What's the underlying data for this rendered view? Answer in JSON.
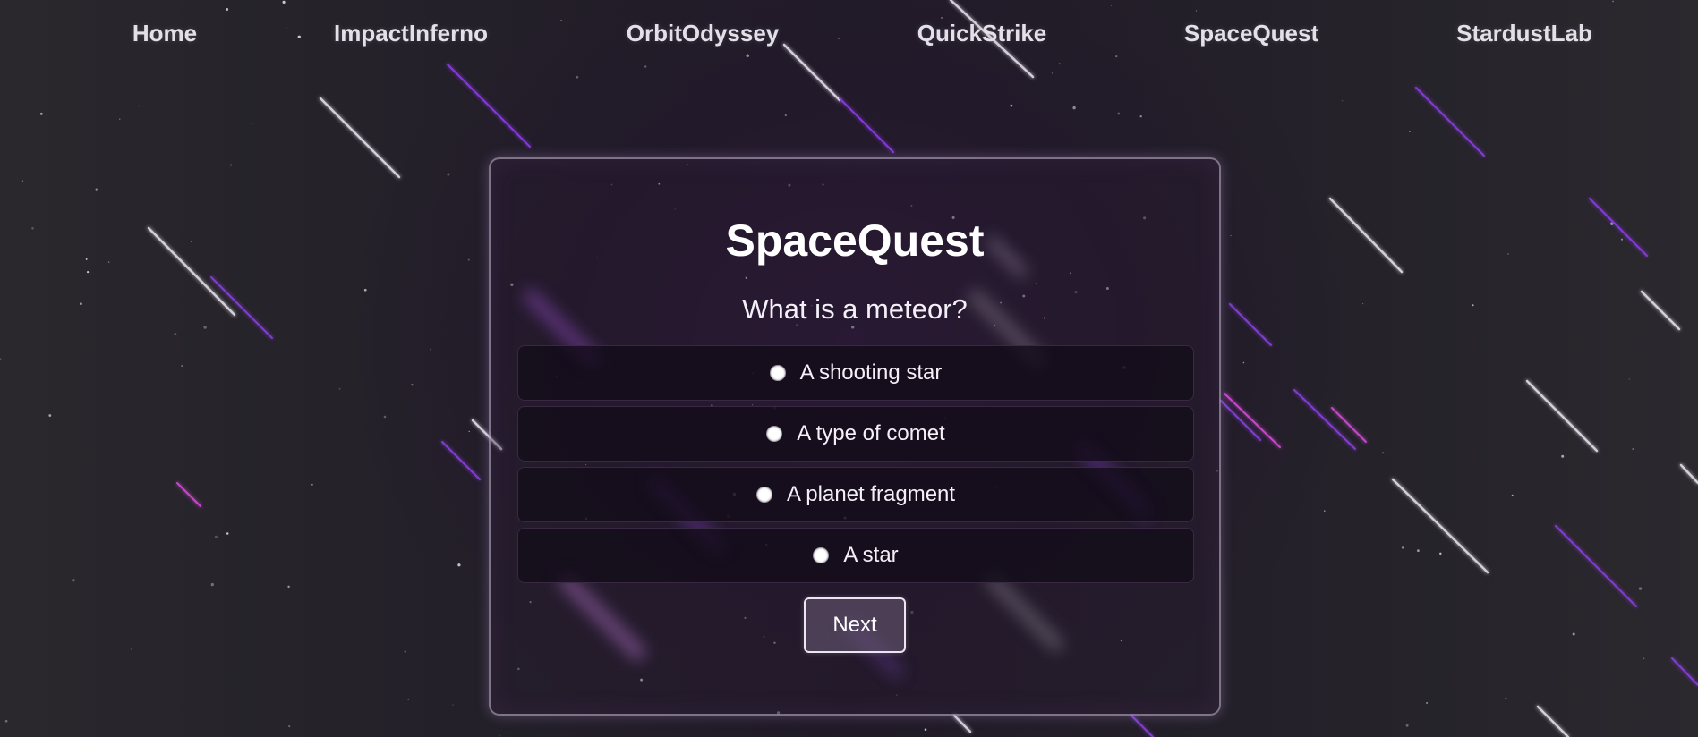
{
  "nav": {
    "items": [
      {
        "label": "Home"
      },
      {
        "label": "ImpactInferno"
      },
      {
        "label": "OrbitOdyssey"
      },
      {
        "label": "QuickStrike"
      },
      {
        "label": "SpaceQuest"
      },
      {
        "label": "StardustLab"
      }
    ]
  },
  "quiz": {
    "title": "SpaceQuest",
    "question": "What is a meteor?",
    "options": [
      {
        "label": "A shooting star",
        "selected": false
      },
      {
        "label": "A type of comet",
        "selected": false
      },
      {
        "label": "A planet fragment",
        "selected": false
      },
      {
        "label": "A star",
        "selected": false
      }
    ],
    "next_label": "Next"
  },
  "colors": {
    "background": "#221c29",
    "meteor_white": "#e6e2ea",
    "meteor_purple": "#8a3ee0",
    "meteor_pink": "#d24ad8",
    "card_border": "#c8bed2"
  }
}
